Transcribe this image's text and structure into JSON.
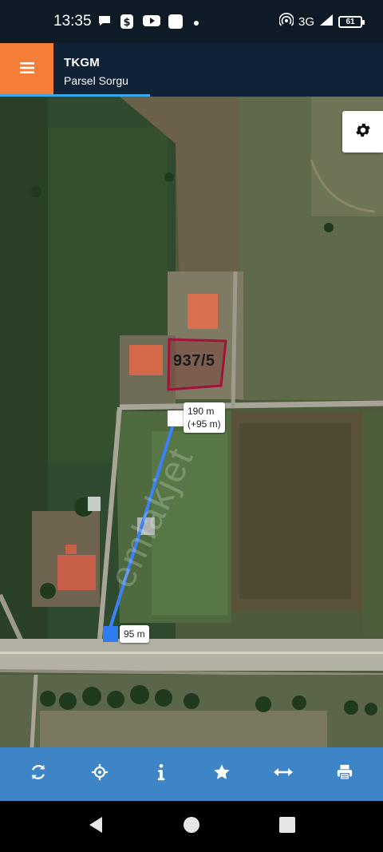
{
  "status_bar": {
    "time": "13:35",
    "network": "3G",
    "battery": "61",
    "icons": [
      "chat-bubble-icon",
      "bluetooth-s-icon",
      "youtube-icon",
      "app-square-icon",
      "dot-icon",
      "hotspot-icon",
      "signal-icon"
    ]
  },
  "header": {
    "title": "TKGM",
    "subtitle": "Parsel Sorgu",
    "menu_icon": "hamburger-icon",
    "accent": "#f47d37"
  },
  "map": {
    "parcel_label": "937/5",
    "measure_total": "190 m",
    "measure_added": "(+95 m)",
    "measure_segment": "95 m",
    "watermark": "emlakjet",
    "settings_icon": "gear-icon",
    "line_color": "#3b82f6",
    "parcel_color": "#a3123a"
  },
  "toolbar": {
    "tools": [
      {
        "name": "refresh",
        "icon": "refresh-icon"
      },
      {
        "name": "locate",
        "icon": "crosshair-icon"
      },
      {
        "name": "info",
        "icon": "info-icon"
      },
      {
        "name": "favorite",
        "icon": "star-icon"
      },
      {
        "name": "measure",
        "icon": "arrows-horizontal-icon"
      },
      {
        "name": "print",
        "icon": "printer-icon"
      }
    ],
    "color": "#3d85c6"
  },
  "nav_bar": {
    "icons": [
      "back-icon",
      "home-icon",
      "recents-icon"
    ]
  }
}
